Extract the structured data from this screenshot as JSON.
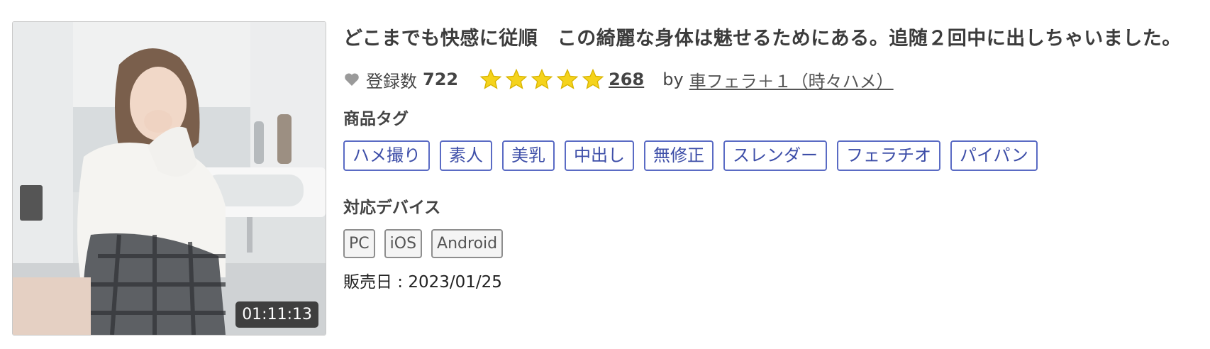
{
  "product": {
    "title": "どこまでも快感に従順　この綺麗な身体は魅せるためにある。追随２回中に出しちゃいました。",
    "duration": "01:11:13",
    "favorites": {
      "icon": "heart-icon",
      "label": "登録数",
      "count": "722"
    },
    "rating": {
      "stars": 5,
      "max": 5,
      "review_count": "268",
      "star_color": "#f5d31c"
    },
    "seller": {
      "by_label": "by",
      "name": "車フェラ＋１（時々ハメ）"
    },
    "tags_label": "商品タグ",
    "tags": [
      "ハメ撮り",
      "素人",
      "美乳",
      "中出し",
      "無修正",
      "スレンダー",
      "フェラチオ",
      "パイパン"
    ],
    "devices_label": "対応デバイス",
    "devices": [
      "PC",
      "iOS",
      "Android"
    ],
    "release": "販売日 : 2023/01/25"
  },
  "colors": {
    "tag_border": "#5a6bc4",
    "tag_text": "#3d4ea8",
    "star": "#f5d31c"
  }
}
